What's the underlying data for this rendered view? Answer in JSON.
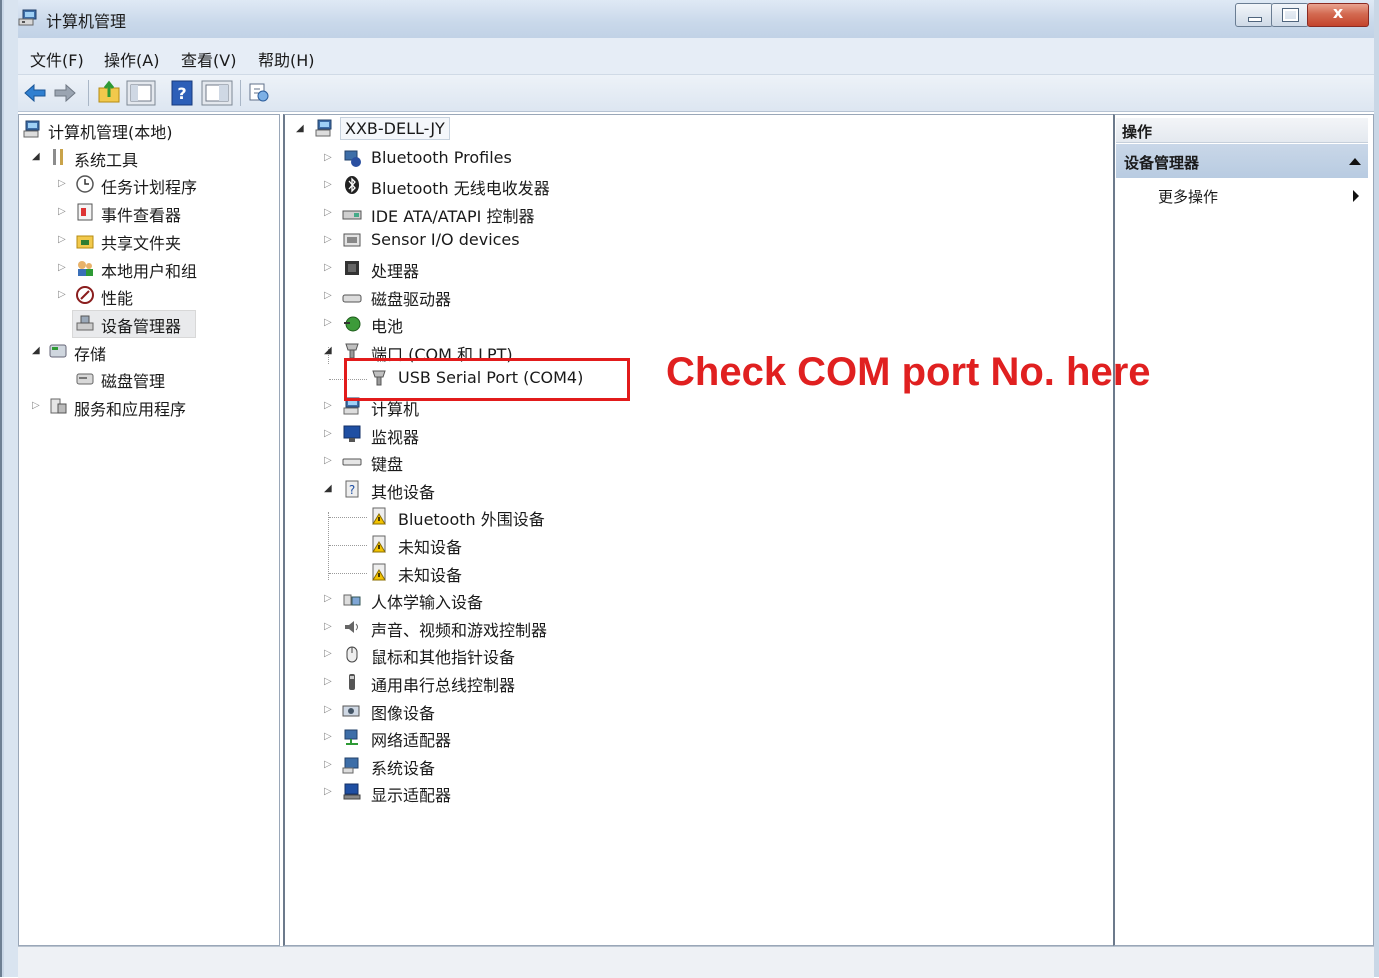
{
  "window": {
    "title": "计算机管理",
    "close_glyph": "x"
  },
  "menu": [
    {
      "label": "文件(F)"
    },
    {
      "label": "操作(A)"
    },
    {
      "label": "查看(V)"
    },
    {
      "label": "帮助(H)"
    }
  ],
  "toolbar": {
    "icons": [
      "back-arrow-icon",
      "forward-arrow-icon",
      "up-folder-icon",
      "show-hide-tree-icon",
      "help-icon",
      "show-hide-action-icon",
      "properties-icon"
    ]
  },
  "left_tree": [
    {
      "label": "计算机管理(本地)",
      "icon": "computer-management-icon",
      "level": 0,
      "expander": "none"
    },
    {
      "label": "系统工具",
      "icon": "system-tools-icon",
      "level": 1,
      "expander": "open"
    },
    {
      "label": "任务计划程序",
      "icon": "clock-icon",
      "level": 2,
      "expander": "closed"
    },
    {
      "label": "事件查看器",
      "icon": "event-viewer-icon",
      "level": 2,
      "expander": "closed"
    },
    {
      "label": "共享文件夹",
      "icon": "shared-folder-icon",
      "level": 2,
      "expander": "closed"
    },
    {
      "label": "本地用户和组",
      "icon": "users-icon",
      "level": 2,
      "expander": "closed"
    },
    {
      "label": "性能",
      "icon": "performance-icon",
      "level": 2,
      "expander": "closed"
    },
    {
      "label": "设备管理器",
      "icon": "device-manager-icon",
      "level": 2,
      "expander": "none",
      "selected": true
    },
    {
      "label": "存储",
      "icon": "storage-icon",
      "level": 1,
      "expander": "open"
    },
    {
      "label": "磁盘管理",
      "icon": "disk-management-icon",
      "level": 2,
      "expander": "none"
    },
    {
      "label": "服务和应用程序",
      "icon": "services-icon",
      "level": 1,
      "expander": "closed"
    }
  ],
  "device_tree": {
    "root": {
      "label": "XXB-DELL-JY",
      "icon": "computer-icon"
    },
    "items": [
      {
        "label": "Bluetooth Profiles",
        "icon": "bluetooth-profiles-icon",
        "level": 1,
        "expander": "closed"
      },
      {
        "label": "Bluetooth 无线电收发器",
        "icon": "bluetooth-icon",
        "level": 1,
        "expander": "closed"
      },
      {
        "label": "IDE ATA/ATAPI 控制器",
        "icon": "ide-controller-icon",
        "level": 1,
        "expander": "closed"
      },
      {
        "label": "Sensor I/O devices",
        "icon": "sensor-icon",
        "level": 1,
        "expander": "closed"
      },
      {
        "label": "处理器",
        "icon": "processor-icon",
        "level": 1,
        "expander": "closed"
      },
      {
        "label": "磁盘驱动器",
        "icon": "disk-drive-icon",
        "level": 1,
        "expander": "closed"
      },
      {
        "label": "电池",
        "icon": "battery-icon",
        "level": 1,
        "expander": "closed"
      },
      {
        "label": "端口 (COM 和 LPT)",
        "icon": "port-icon",
        "level": 1,
        "expander": "open"
      },
      {
        "label": "USB Serial Port (COM4)",
        "icon": "usb-serial-port-icon",
        "level": 2,
        "expander": "none"
      },
      {
        "label": "计算机",
        "icon": "computer-icon",
        "level": 1,
        "expander": "closed"
      },
      {
        "label": "监视器",
        "icon": "monitor-icon",
        "level": 1,
        "expander": "closed"
      },
      {
        "label": "键盘",
        "icon": "keyboard-icon",
        "level": 1,
        "expander": "closed"
      },
      {
        "label": "其他设备",
        "icon": "unknown-device-icon",
        "level": 1,
        "expander": "open"
      },
      {
        "label": "Bluetooth 外围设备",
        "icon": "warning-device-icon",
        "level": 2,
        "expander": "none"
      },
      {
        "label": "未知设备",
        "icon": "warning-device-icon",
        "level": 2,
        "expander": "none"
      },
      {
        "label": "未知设备",
        "icon": "warning-device-icon",
        "level": 2,
        "expander": "none"
      },
      {
        "label": "人体学输入设备",
        "icon": "hid-icon",
        "level": 1,
        "expander": "closed"
      },
      {
        "label": "声音、视频和游戏控制器",
        "icon": "sound-icon",
        "level": 1,
        "expander": "closed"
      },
      {
        "label": "鼠标和其他指针设备",
        "icon": "mouse-icon",
        "level": 1,
        "expander": "closed"
      },
      {
        "label": "通用串行总线控制器",
        "icon": "usb-controller-icon",
        "level": 1,
        "expander": "closed"
      },
      {
        "label": "图像设备",
        "icon": "imaging-device-icon",
        "level": 1,
        "expander": "closed"
      },
      {
        "label": "网络适配器",
        "icon": "network-adapter-icon",
        "level": 1,
        "expander": "closed"
      },
      {
        "label": "系统设备",
        "icon": "system-device-icon",
        "level": 1,
        "expander": "closed"
      },
      {
        "label": "显示适配器",
        "icon": "display-adapter-icon",
        "level": 1,
        "expander": "closed"
      }
    ]
  },
  "actions": {
    "header": "操作",
    "section": "设备管理器",
    "more": "更多操作"
  },
  "annotation": {
    "text": "Check COM port No. here",
    "color": "#e02020"
  },
  "colors": {
    "title_bar": "#c9d8ea",
    "highlight": "#e21b1b"
  }
}
